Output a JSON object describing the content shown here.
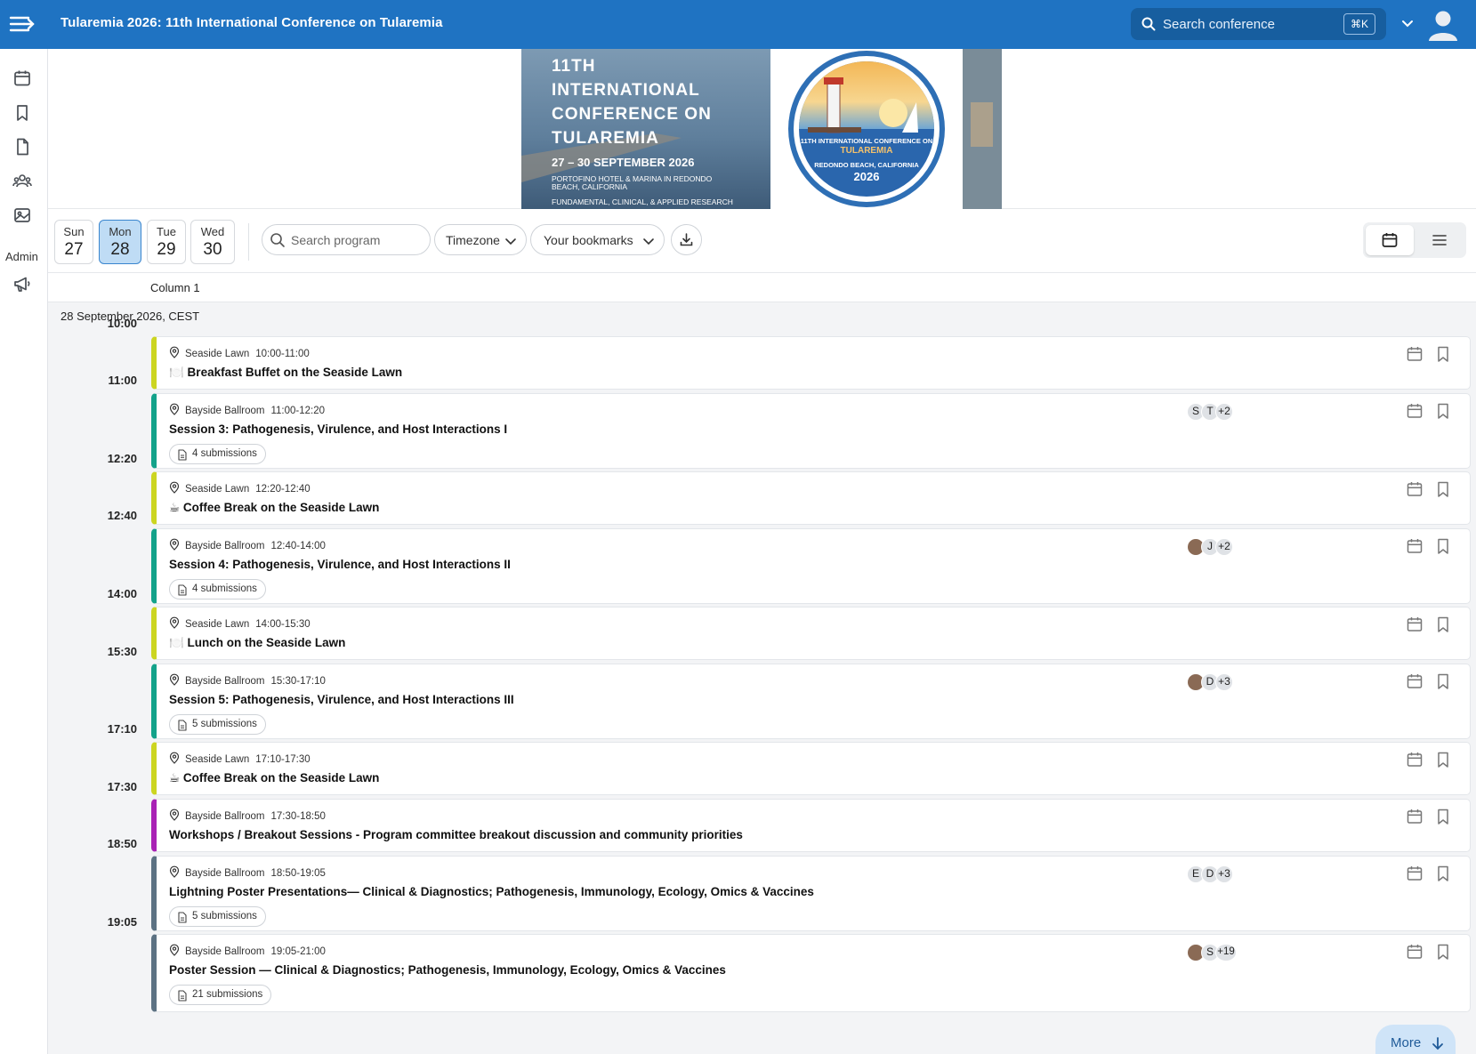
{
  "app": {
    "title": "Tularemia 2026: 11th International Conference on Tularemia"
  },
  "search": {
    "placeholder": "Search conference",
    "shortcut": "⌘K"
  },
  "sidebar": {
    "admin_label": "Admin",
    "icons": [
      "calendar-icon",
      "bookmark-icon",
      "document-icon",
      "people-icon",
      "image-icon",
      "megaphone-icon"
    ]
  },
  "banner": {
    "line1": "11TH",
    "line2": "INTERNATIONAL",
    "line3": "CONFERENCE ON",
    "line4": "TULAREMIA",
    "dates": "27 – 30 SEPTEMBER 2026",
    "venue1": "PORTOFINO HOTEL & MARINA IN REDONDO",
    "venue2": "BEACH, CALIFORNIA",
    "tagline": "FUNDAMENTAL, CLINICAL, & APPLIED RESEARCH",
    "seal_top": "11TH INTERNATIONAL CONFERENCE ON",
    "seal_name": "TULAREMIA",
    "seal_place": "REDONDO BEACH, CALIFORNIA",
    "seal_year": "2026"
  },
  "days": [
    {
      "dow": "Sun",
      "num": "27"
    },
    {
      "dow": "Mon",
      "num": "28"
    },
    {
      "dow": "Tue",
      "num": "29"
    },
    {
      "dow": "Wed",
      "num": "30"
    }
  ],
  "toolbar": {
    "search_placeholder": "Search program",
    "timezone_label": "Timezone",
    "bookmarks_label": "Your bookmarks"
  },
  "column": {
    "header": "Column 1"
  },
  "day_label": "28 September 2026, CEST",
  "time_labels": [
    "10:00",
    "11:00",
    "12:20",
    "12:40",
    "14:00",
    "15:30",
    "17:10",
    "17:30",
    "18:50",
    "19:05"
  ],
  "events": [
    {
      "room": "Seaside Lawn",
      "time": "10:00-11:00",
      "title": "🍽️ Breakfast Buffet on the Seaside Lawn",
      "type": "break"
    },
    {
      "room": "Bayside Ballroom",
      "time": "11:00-12:20",
      "title": "Session 3: Pathogenesis, Virulence, and Host Interactions I",
      "type": "session",
      "submissions": "4 submissions",
      "avatars": [
        "S",
        "T",
        "+2"
      ]
    },
    {
      "room": "Seaside Lawn",
      "time": "12:20-12:40",
      "title": "☕ Coffee Break on the Seaside Lawn",
      "type": "break"
    },
    {
      "room": "Bayside Ballroom",
      "time": "12:40-14:00",
      "title": "Session 4: Pathogenesis, Virulence, and Host Interactions II",
      "type": "session",
      "submissions": "4 submissions",
      "avatars": [
        "",
        "J",
        "+2"
      ]
    },
    {
      "room": "Seaside Lawn",
      "time": "14:00-15:30",
      "title": "🍽️ Lunch on the Seaside Lawn",
      "type": "break"
    },
    {
      "room": "Bayside Ballroom",
      "time": "15:30-17:10",
      "title": "Session 5: Pathogenesis, Virulence, and Host Interactions III",
      "type": "session",
      "submissions": "5 submissions",
      "avatars": [
        "",
        "D",
        "+3"
      ]
    },
    {
      "room": "Seaside Lawn",
      "time": "17:10-17:30",
      "title": "☕ Coffee Break on the Seaside Lawn",
      "type": "break"
    },
    {
      "room": "Bayside Ballroom",
      "time": "17:30-18:50",
      "title": "Workshops / Breakout Sessions - Program committee breakout discussion and community priorities",
      "type": "work"
    },
    {
      "room": "Bayside Ballroom",
      "time": "18:50-19:05",
      "title": "Lightning Poster Presentations— Clinical & Diagnostics; Pathogenesis, Immunology, Ecology, Omics & Vaccines",
      "type": "poster",
      "submissions": "5 submissions",
      "avatars": [
        "E",
        "D",
        "+3"
      ]
    },
    {
      "room": "Bayside Ballroom",
      "time": "19:05-21:00",
      "title": "Poster Session — Clinical & Diagnostics; Pathogenesis, Immunology, Ecology, Omics & Vaccines",
      "type": "poster",
      "submissions": "21 submissions",
      "avatars": [
        "",
        "S",
        "+19"
      ]
    }
  ],
  "more_label": "More",
  "colors": {
    "topbar": "#1f73c2",
    "break": "#ccd521",
    "session": "#13a28a",
    "workshop": "#a922b5",
    "poster": "#5c7283",
    "active_day": "#bfdcf5"
  }
}
